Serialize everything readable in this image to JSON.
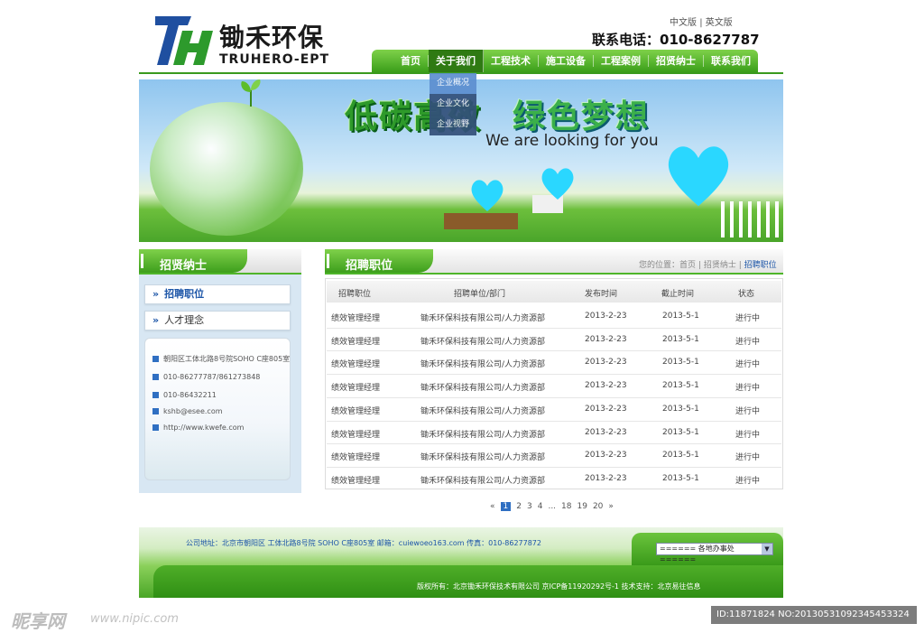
{
  "header": {
    "logo_cn": "锄禾环保",
    "logo_en": "TRUHERO-EPT",
    "lang_cn": "中文版",
    "lang_sep": "|",
    "lang_en": "英文版",
    "phone": "联系电话：010-8627787"
  },
  "nav": {
    "items": [
      "首页",
      "关于我们",
      "工程技术",
      "施工设备",
      "工程案例",
      "招贤纳士",
      "联系我们"
    ],
    "dropdown": [
      "企业概况",
      "企业文化",
      "企业视野"
    ]
  },
  "banner": {
    "slogan_1": "低碳高效",
    "slogan_2": "绿色梦想",
    "tagline": "We are looking for you"
  },
  "sidebar": {
    "title": "招贤纳士",
    "items": [
      "招聘职位",
      "人才理念"
    ],
    "contact": {
      "address": "朝阳区工体北路8号院SOHO C座805室",
      "phone": "010-86277787/861273848",
      "fax": "010-86432211",
      "email": "kshb@esee.com",
      "web": "http://www.kwefe.com"
    }
  },
  "main": {
    "title": "招聘职位",
    "breadcrumb": {
      "prefix": "您的位置：",
      "home": "首页",
      "sep": "|",
      "parent": "招贤纳士",
      "current": "招聘职位"
    },
    "columns": [
      "招聘职位",
      "招聘单位/部门",
      "发布时间",
      "截止时间",
      "状态"
    ],
    "rows": [
      [
        "绩效管理经理",
        "锄禾环保科技有限公司/人力资源部",
        "2013-2-23",
        "2013-5-1",
        "进行中"
      ],
      [
        "绩效管理经理",
        "锄禾环保科技有限公司/人力资源部",
        "2013-2-23",
        "2013-5-1",
        "进行中"
      ],
      [
        "绩效管理经理",
        "锄禾环保科技有限公司/人力资源部",
        "2013-2-23",
        "2013-5-1",
        "进行中"
      ],
      [
        "绩效管理经理",
        "锄禾环保科技有限公司/人力资源部",
        "2013-2-23",
        "2013-5-1",
        "进行中"
      ],
      [
        "绩效管理经理",
        "锄禾环保科技有限公司/人力资源部",
        "2013-2-23",
        "2013-5-1",
        "进行中"
      ],
      [
        "绩效管理经理",
        "锄禾环保科技有限公司/人力资源部",
        "2013-2-23",
        "2013-5-1",
        "进行中"
      ],
      [
        "绩效管理经理",
        "锄禾环保科技有限公司/人力资源部",
        "2013-2-23",
        "2013-5-1",
        "进行中"
      ],
      [
        "绩效管理经理",
        "锄禾环保科技有限公司/人力资源部",
        "2013-2-23",
        "2013-5-1",
        "进行中"
      ]
    ],
    "pager": {
      "prev": "«",
      "pages": [
        "1",
        "2",
        "3",
        "4",
        "...",
        "18",
        "19",
        "20"
      ],
      "next": "»"
    }
  },
  "footer": {
    "address_line": "公司地址：北京市朝阳区 工体北路8号院 SOHO C座805室    邮箱：cuiewoeo163.com    传真：010-86277872",
    "copyright": "版权所有：北京锄禾环保技术有限公司    京ICP备11920292号-1    技术支持：北京易往信息",
    "select_value": "====== 各地办事处 ======"
  },
  "watermark": {
    "brand": "昵享网",
    "url": "www.nipic.com",
    "id": "ID:11871824 NO:20130531092345453324"
  },
  "colors": {
    "brand_green": "#3a9e1a",
    "link_blue": "#1d56a8",
    "heart_cyan": "#2ad7ff"
  }
}
